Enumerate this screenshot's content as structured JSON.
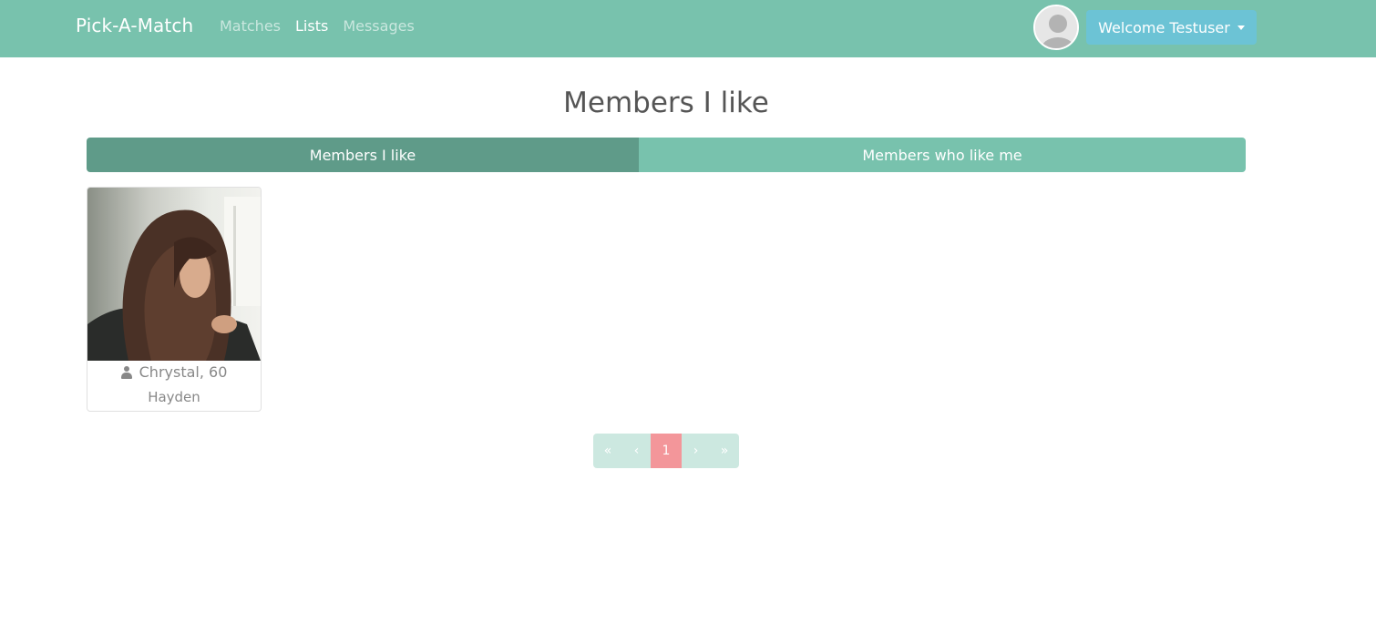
{
  "navbar": {
    "brand": "Pick-A-Match",
    "links": [
      {
        "label": "Matches",
        "active": false
      },
      {
        "label": "Lists",
        "active": true
      },
      {
        "label": "Messages",
        "active": false
      }
    ],
    "welcome_label": "Welcome Testuser",
    "avatar_icon": "user-avatar-placeholder-icon"
  },
  "page": {
    "title": "Members I like"
  },
  "tabs": [
    {
      "label": "Members I like",
      "active": true
    },
    {
      "label": "Members who like me",
      "active": false
    }
  ],
  "members": [
    {
      "name_age": "Chrystal, 60",
      "city": "Hayden",
      "icon": "user-icon"
    }
  ],
  "pagination": {
    "first": "«",
    "prev": "‹",
    "current": "1",
    "next": "›",
    "last": "»"
  },
  "colors": {
    "primary": "#78c2ad",
    "primary_active": "#5f9b89",
    "info": "#6cc3d5",
    "secondary_pagination": "#f3969a"
  }
}
